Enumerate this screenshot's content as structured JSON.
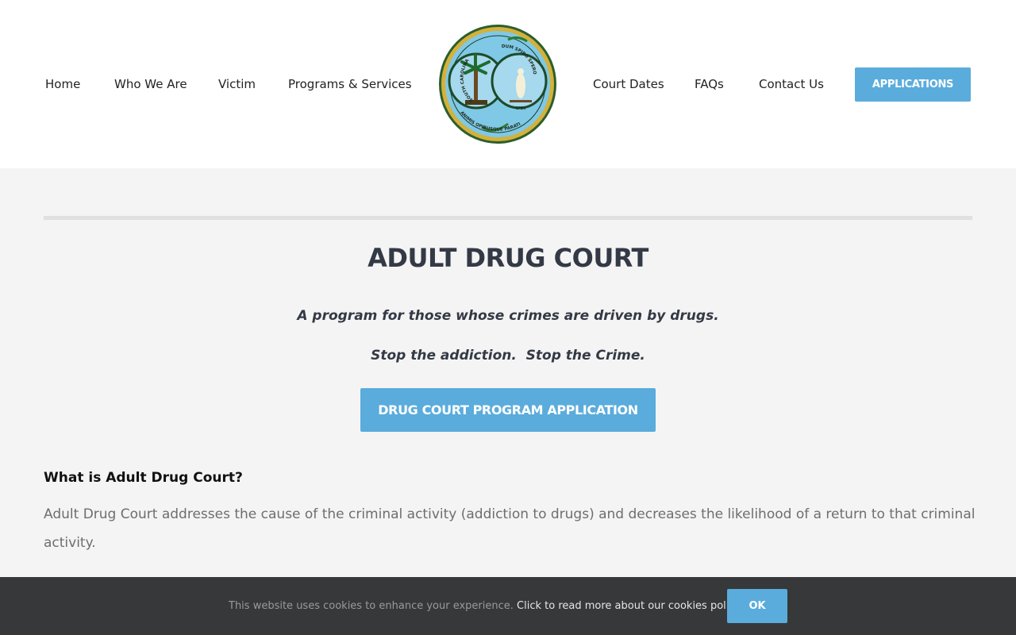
{
  "nav": {
    "home": "Home",
    "who_we_are": "Who We Are",
    "victim": "Victim",
    "programs": "Programs & Services",
    "court_dates": "Court Dates",
    "faqs": "FAQs",
    "contact": "Contact Us",
    "applications": "APPLICATIONS"
  },
  "logo": {
    "icon": "south-carolina-state-seal",
    "text_left": "SOUTH CAROLINA",
    "text_right": "DUM SPIRO SPERO",
    "text_bottom": "ANIMIS OPIBUSQUE PARATI",
    "text_spes": "SPES"
  },
  "main": {
    "title": "ADULT DRUG COURT",
    "tagline1": "A program for those whose crimes are driven by drugs.",
    "tagline2": "Stop the addiction.  Stop the Crime.",
    "program_button": "DRUG COURT PROGRAM APPLICATION",
    "section_heading": "What is Adult Drug Court?",
    "section_body": "Adult Drug Court addresses the cause of the criminal activity (addiction to drugs) and decreases the likelihood of a return to that criminal activity."
  },
  "cookie": {
    "text": "This website uses cookies to enhance your experience.",
    "link": "Click to read more about our cookies policy.",
    "ok": "OK"
  },
  "colors": {
    "accent": "#5aacdc",
    "page_bg": "#f4f4f4",
    "heading": "#333945",
    "cookie_bg": "#363839"
  }
}
